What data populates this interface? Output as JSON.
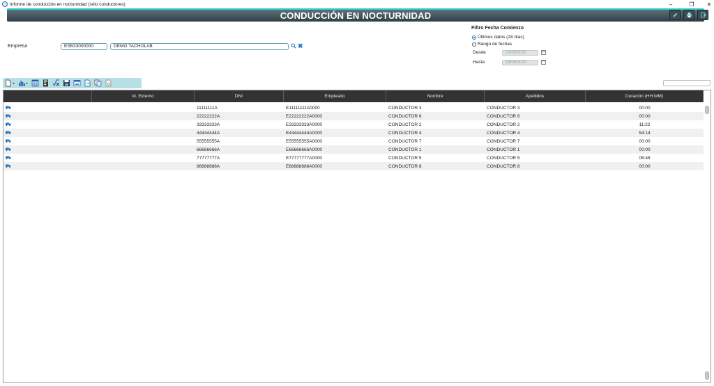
{
  "window": {
    "title": "Informe de conducción en nocturnidad (sólo conductores)",
    "minimize": "–",
    "maximize": "❐",
    "close": "✕"
  },
  "header": {
    "title": "CONDUCCIÓN EN NOCTURNIDAD"
  },
  "company": {
    "label": "Empresa",
    "code": "ESB33000000",
    "name": "DEMO TACHOLAB"
  },
  "filter": {
    "title": "Filtro Fecha Comienzo",
    "option_last": "Últimos datos (28 días)",
    "option_range": "Rango de fechas",
    "selected": "last",
    "from_label": "Desde",
    "from_value": "21/05/2020",
    "to_label": "Hasta",
    "to_value": "18/06/2020"
  },
  "toolbar": {
    "icons": [
      "new-document-icon",
      "chart-icon",
      "calendar-grid-icon",
      "calculator-icon",
      "formula-icon",
      "save-icon",
      "report-icon",
      "export-icon",
      "copy-icon",
      "print-preview-icon"
    ]
  },
  "table": {
    "columns": [
      "",
      "Id. Externo",
      "DNI",
      "Empleado",
      "Nombre",
      "Apellidos",
      "Duración (HH:MM)"
    ],
    "rows": [
      {
        "id_externo": "",
        "dni": "11111111A",
        "empleado": "E11111111A0000",
        "nombre": "CONDUCTOR 3",
        "apellidos": "CONDUCTOR 3",
        "duracion": "00:00"
      },
      {
        "id_externo": "",
        "dni": "22222222A",
        "empleado": "E22222222A0000",
        "nombre": "CONDUCTOR 6",
        "apellidos": "CONDUCTOR 6",
        "duracion": "00:00"
      },
      {
        "id_externo": "",
        "dni": "33333333A",
        "empleado": "E33333333A0000",
        "nombre": "CONDUCTOR 2",
        "apellidos": "CONDUCTOR 2",
        "duracion": "11:22"
      },
      {
        "id_externo": "",
        "dni": "44444444A",
        "empleado": "E44444444A0000",
        "nombre": "CONDUCTOR 4",
        "apellidos": "CONDUCTOR 4",
        "duracion": "54:14"
      },
      {
        "id_externo": "",
        "dni": "55555555A",
        "empleado": "E55555555A0000",
        "nombre": "CONDUCTOR 7",
        "apellidos": "CONDUCTOR 7",
        "duracion": "00:00"
      },
      {
        "id_externo": "",
        "dni": "66666666A",
        "empleado": "E66666666A0000",
        "nombre": "CONDUCTOR 1",
        "apellidos": "CONDUCTOR 1",
        "duracion": "00:00"
      },
      {
        "id_externo": "",
        "dni": "77777777A",
        "empleado": "E77777777A0000",
        "nombre": "CONDUCTOR 5",
        "apellidos": "CONDUCTOR 5",
        "duracion": "06:48"
      },
      {
        "id_externo": "",
        "dni": "88888888A",
        "empleado": "E88888888A0000",
        "nombre": "CONDUCTOR 8",
        "apellidos": "CONDUCTOR 8",
        "duracion": "00:00"
      }
    ]
  },
  "colors": {
    "accent": "#2fd0cf",
    "header_bg": "#333333",
    "toolbar_bg": "#b9dfe6",
    "icon_blue": "#1f79c8"
  }
}
